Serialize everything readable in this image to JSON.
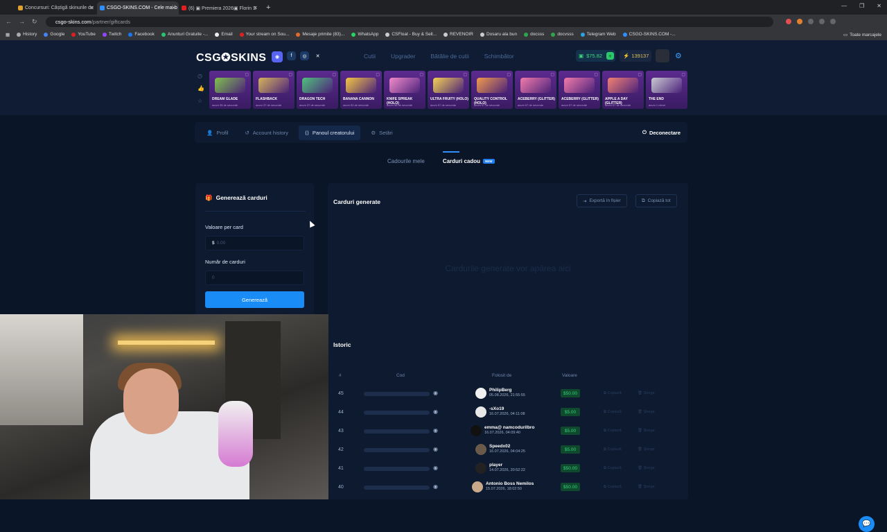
{
  "browser": {
    "tabs": [
      {
        "title": "Concursuri: Câștigă skinurile de",
        "color": "#e0a030"
      },
      {
        "title": "CSGO-SKINS.COM - Cele mai b",
        "color": "#2f8fff",
        "active": true
      },
      {
        "title": "(6) ▣ Premiera 2026▣ Florin S",
        "color": "#e02020"
      }
    ],
    "new_tab": "+",
    "url_host": "csgo-skins.com",
    "url_path": "/partner/giftcards",
    "bookmarks": [
      {
        "label": "History",
        "color": "#aaa"
      },
      {
        "label": "Google",
        "color": "#4285f4"
      },
      {
        "label": "YouTube",
        "color": "#e02020"
      },
      {
        "label": "Twitch",
        "color": "#9146ff"
      },
      {
        "label": "Facebook",
        "color": "#1877f2"
      },
      {
        "label": "Anunturi Gratuite -...",
        "color": "#29c46e"
      },
      {
        "label": "Email",
        "color": "#eee"
      },
      {
        "label": "Your stream on Sou...",
        "color": "#e02020"
      },
      {
        "label": "Mesaje primite (83)...",
        "color": "#e06a2a"
      },
      {
        "label": "WhatsApp",
        "color": "#25d366"
      },
      {
        "label": "CSFloat - Buy & Sell...",
        "color": "#ccc"
      },
      {
        "label": "REVENOIR",
        "color": "#ccc"
      },
      {
        "label": "Dosaru ala bun",
        "color": "#ccc"
      },
      {
        "label": "docsss",
        "color": "#2ea44f"
      },
      {
        "label": "docvsss",
        "color": "#2ea44f"
      },
      {
        "label": "Telegram Web",
        "color": "#2aa3e0"
      },
      {
        "label": "CSGO-SKINS.COM -...",
        "color": "#2f8fff"
      }
    ],
    "bookmarks_right": "Toate marcajele"
  },
  "site": {
    "logo": "CSG✪SKINS",
    "nav": [
      "Cutii",
      "Upgrader",
      "Bătălie de cutii",
      "Schimbător"
    ],
    "balance": "$75.82",
    "coins": "139137",
    "drops": [
      {
        "name": "DREAM GLADE",
        "time": "acum 35 de secunde",
        "color": "#7fbf4a"
      },
      {
        "name": "FLASHBACK",
        "time": "acum 37 de secunde",
        "color": "#d4b35a"
      },
      {
        "name": "DRAGON TECH",
        "time": "acum 37 de secunde",
        "color": "#4fbf7a"
      },
      {
        "name": "BANANA CANNON",
        "time": "acum 53 de secunde",
        "color": "#f2c640"
      },
      {
        "name": "KNIFE SPREAK (HOLO)",
        "time": "acum 58 de secunde",
        "color": "#f08ac8"
      },
      {
        "name": "ULTRA FRUITY (HOLO)",
        "time": "acum 57 de secunde",
        "color": "#f3d050"
      },
      {
        "name": "QUALITY CONTROL (HOLO)",
        "time": "acum 57 de secunde",
        "color": "#ef9a4a"
      },
      {
        "name": "ACEBERRY (GLITTER)",
        "time": "acum 57 de secunde",
        "color": "#f07aa8"
      },
      {
        "name": "ACEBERRY (GLITTER)",
        "time": "acum 57 de secunde",
        "color": "#f07aa8"
      },
      {
        "name": "APPLE A DAY (GLITTER)",
        "time": "acum 57 de secunde",
        "color": "#f08070"
      },
      {
        "name": "THE END",
        "time": "acum 1 minut",
        "color": "#c8c8d0"
      }
    ],
    "menu": [
      "Profil",
      "Account history",
      "Panoul creatorului",
      "Setări"
    ],
    "logout": "Deconectare",
    "subtabs": [
      "Cadourile mele",
      "Carduri cadou"
    ],
    "new_badge": "NEW"
  },
  "generate": {
    "title": "Generează carduri",
    "value_label": "Valoare per card",
    "value_prefix": "$",
    "value_placeholder": "0.00",
    "count_label": "Număr de carduri",
    "count_placeholder": "0",
    "button": "Generează"
  },
  "generated": {
    "title": "Carduri generate",
    "export": "Exportă în fișier",
    "copy_all": "Copiază tot",
    "empty": "Cardurile generate vor apărea aici"
  },
  "history": {
    "title": "Istoric",
    "headers": [
      "#",
      "Cod",
      "Folosit de",
      "Valoare"
    ],
    "copy": "Copiază",
    "delete": "Șterge",
    "rows": [
      {
        "n": "45",
        "user": "PhilipBerg",
        "date": "05.08.2026, 21:55:55",
        "value": "$50.00"
      },
      {
        "n": "44",
        "user": "-sXo19",
        "date": "16.07.2026, 04:11:08",
        "value": "$5.00"
      },
      {
        "n": "43",
        "user": "emma@ namcodurilbro",
        "date": "16.07.2026, 04:09:40",
        "value": "$5.00"
      },
      {
        "n": "42",
        "user": "Speedx02",
        "date": "16.07.2026, 04:04:25",
        "value": "$5.00"
      },
      {
        "n": "41",
        "user": "player",
        "date": "14.07.2026, 20:52:22",
        "value": "$50.00"
      },
      {
        "n": "40",
        "user": "Antonio Boss Nemilos",
        "date": "15.07.2026, 18:02:50",
        "value": "$50.00"
      }
    ]
  }
}
